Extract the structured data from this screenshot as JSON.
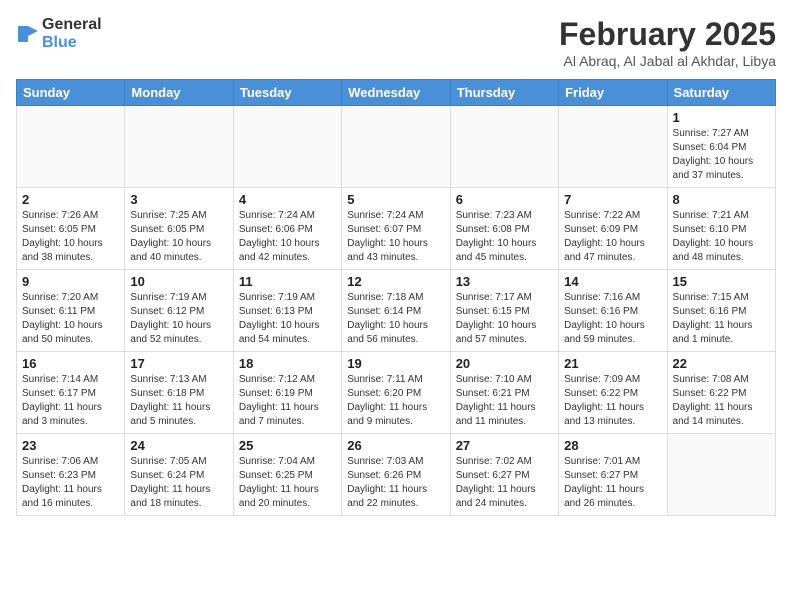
{
  "header": {
    "logo_general": "General",
    "logo_blue": "Blue",
    "month_title": "February 2025",
    "location": "Al Abraq, Al Jabal al Akhdar, Libya"
  },
  "weekdays": [
    "Sunday",
    "Monday",
    "Tuesday",
    "Wednesday",
    "Thursday",
    "Friday",
    "Saturday"
  ],
  "weeks": [
    [
      {
        "day": "",
        "detail": ""
      },
      {
        "day": "",
        "detail": ""
      },
      {
        "day": "",
        "detail": ""
      },
      {
        "day": "",
        "detail": ""
      },
      {
        "day": "",
        "detail": ""
      },
      {
        "day": "",
        "detail": ""
      },
      {
        "day": "1",
        "detail": "Sunrise: 7:27 AM\nSunset: 6:04 PM\nDaylight: 10 hours and 37 minutes."
      }
    ],
    [
      {
        "day": "2",
        "detail": "Sunrise: 7:26 AM\nSunset: 6:05 PM\nDaylight: 10 hours and 38 minutes."
      },
      {
        "day": "3",
        "detail": "Sunrise: 7:25 AM\nSunset: 6:05 PM\nDaylight: 10 hours and 40 minutes."
      },
      {
        "day": "4",
        "detail": "Sunrise: 7:24 AM\nSunset: 6:06 PM\nDaylight: 10 hours and 42 minutes."
      },
      {
        "day": "5",
        "detail": "Sunrise: 7:24 AM\nSunset: 6:07 PM\nDaylight: 10 hours and 43 minutes."
      },
      {
        "day": "6",
        "detail": "Sunrise: 7:23 AM\nSunset: 6:08 PM\nDaylight: 10 hours and 45 minutes."
      },
      {
        "day": "7",
        "detail": "Sunrise: 7:22 AM\nSunset: 6:09 PM\nDaylight: 10 hours and 47 minutes."
      },
      {
        "day": "8",
        "detail": "Sunrise: 7:21 AM\nSunset: 6:10 PM\nDaylight: 10 hours and 48 minutes."
      }
    ],
    [
      {
        "day": "9",
        "detail": "Sunrise: 7:20 AM\nSunset: 6:11 PM\nDaylight: 10 hours and 50 minutes."
      },
      {
        "day": "10",
        "detail": "Sunrise: 7:19 AM\nSunset: 6:12 PM\nDaylight: 10 hours and 52 minutes."
      },
      {
        "day": "11",
        "detail": "Sunrise: 7:19 AM\nSunset: 6:13 PM\nDaylight: 10 hours and 54 minutes."
      },
      {
        "day": "12",
        "detail": "Sunrise: 7:18 AM\nSunset: 6:14 PM\nDaylight: 10 hours and 56 minutes."
      },
      {
        "day": "13",
        "detail": "Sunrise: 7:17 AM\nSunset: 6:15 PM\nDaylight: 10 hours and 57 minutes."
      },
      {
        "day": "14",
        "detail": "Sunrise: 7:16 AM\nSunset: 6:16 PM\nDaylight: 10 hours and 59 minutes."
      },
      {
        "day": "15",
        "detail": "Sunrise: 7:15 AM\nSunset: 6:16 PM\nDaylight: 11 hours and 1 minute."
      }
    ],
    [
      {
        "day": "16",
        "detail": "Sunrise: 7:14 AM\nSunset: 6:17 PM\nDaylight: 11 hours and 3 minutes."
      },
      {
        "day": "17",
        "detail": "Sunrise: 7:13 AM\nSunset: 6:18 PM\nDaylight: 11 hours and 5 minutes."
      },
      {
        "day": "18",
        "detail": "Sunrise: 7:12 AM\nSunset: 6:19 PM\nDaylight: 11 hours and 7 minutes."
      },
      {
        "day": "19",
        "detail": "Sunrise: 7:11 AM\nSunset: 6:20 PM\nDaylight: 11 hours and 9 minutes."
      },
      {
        "day": "20",
        "detail": "Sunrise: 7:10 AM\nSunset: 6:21 PM\nDaylight: 11 hours and 11 minutes."
      },
      {
        "day": "21",
        "detail": "Sunrise: 7:09 AM\nSunset: 6:22 PM\nDaylight: 11 hours and 13 minutes."
      },
      {
        "day": "22",
        "detail": "Sunrise: 7:08 AM\nSunset: 6:22 PM\nDaylight: 11 hours and 14 minutes."
      }
    ],
    [
      {
        "day": "23",
        "detail": "Sunrise: 7:06 AM\nSunset: 6:23 PM\nDaylight: 11 hours and 16 minutes."
      },
      {
        "day": "24",
        "detail": "Sunrise: 7:05 AM\nSunset: 6:24 PM\nDaylight: 11 hours and 18 minutes."
      },
      {
        "day": "25",
        "detail": "Sunrise: 7:04 AM\nSunset: 6:25 PM\nDaylight: 11 hours and 20 minutes."
      },
      {
        "day": "26",
        "detail": "Sunrise: 7:03 AM\nSunset: 6:26 PM\nDaylight: 11 hours and 22 minutes."
      },
      {
        "day": "27",
        "detail": "Sunrise: 7:02 AM\nSunset: 6:27 PM\nDaylight: 11 hours and 24 minutes."
      },
      {
        "day": "28",
        "detail": "Sunrise: 7:01 AM\nSunset: 6:27 PM\nDaylight: 11 hours and 26 minutes."
      },
      {
        "day": "",
        "detail": ""
      }
    ]
  ]
}
